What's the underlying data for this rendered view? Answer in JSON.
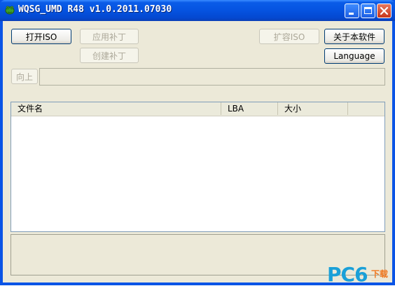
{
  "window": {
    "title": "WQSG_UMD R48 v1.0.2011.07030",
    "icon": "frog-app-icon"
  },
  "titlebar_buttons": {
    "minimize": "minimize-icon",
    "maximize": "maximize-icon",
    "close": "close-icon"
  },
  "toolbar": {
    "open_iso": "打开ISO",
    "apply_patch": "应用补丁",
    "create_patch": "创建补丁",
    "expand_iso": "扩容ISO",
    "about": "关于本软件",
    "language": "Language",
    "up": "向上"
  },
  "path_field": {
    "value": ""
  },
  "file_list": {
    "columns": [
      "文件名",
      "LBA",
      "大小",
      ""
    ],
    "rows": []
  },
  "watermark": {
    "brand": "PC6",
    "sub": "下载"
  },
  "colors": {
    "window_face": "#ece9d8",
    "titlebar": "#0553e0",
    "watermark": "#1aa0d8"
  }
}
